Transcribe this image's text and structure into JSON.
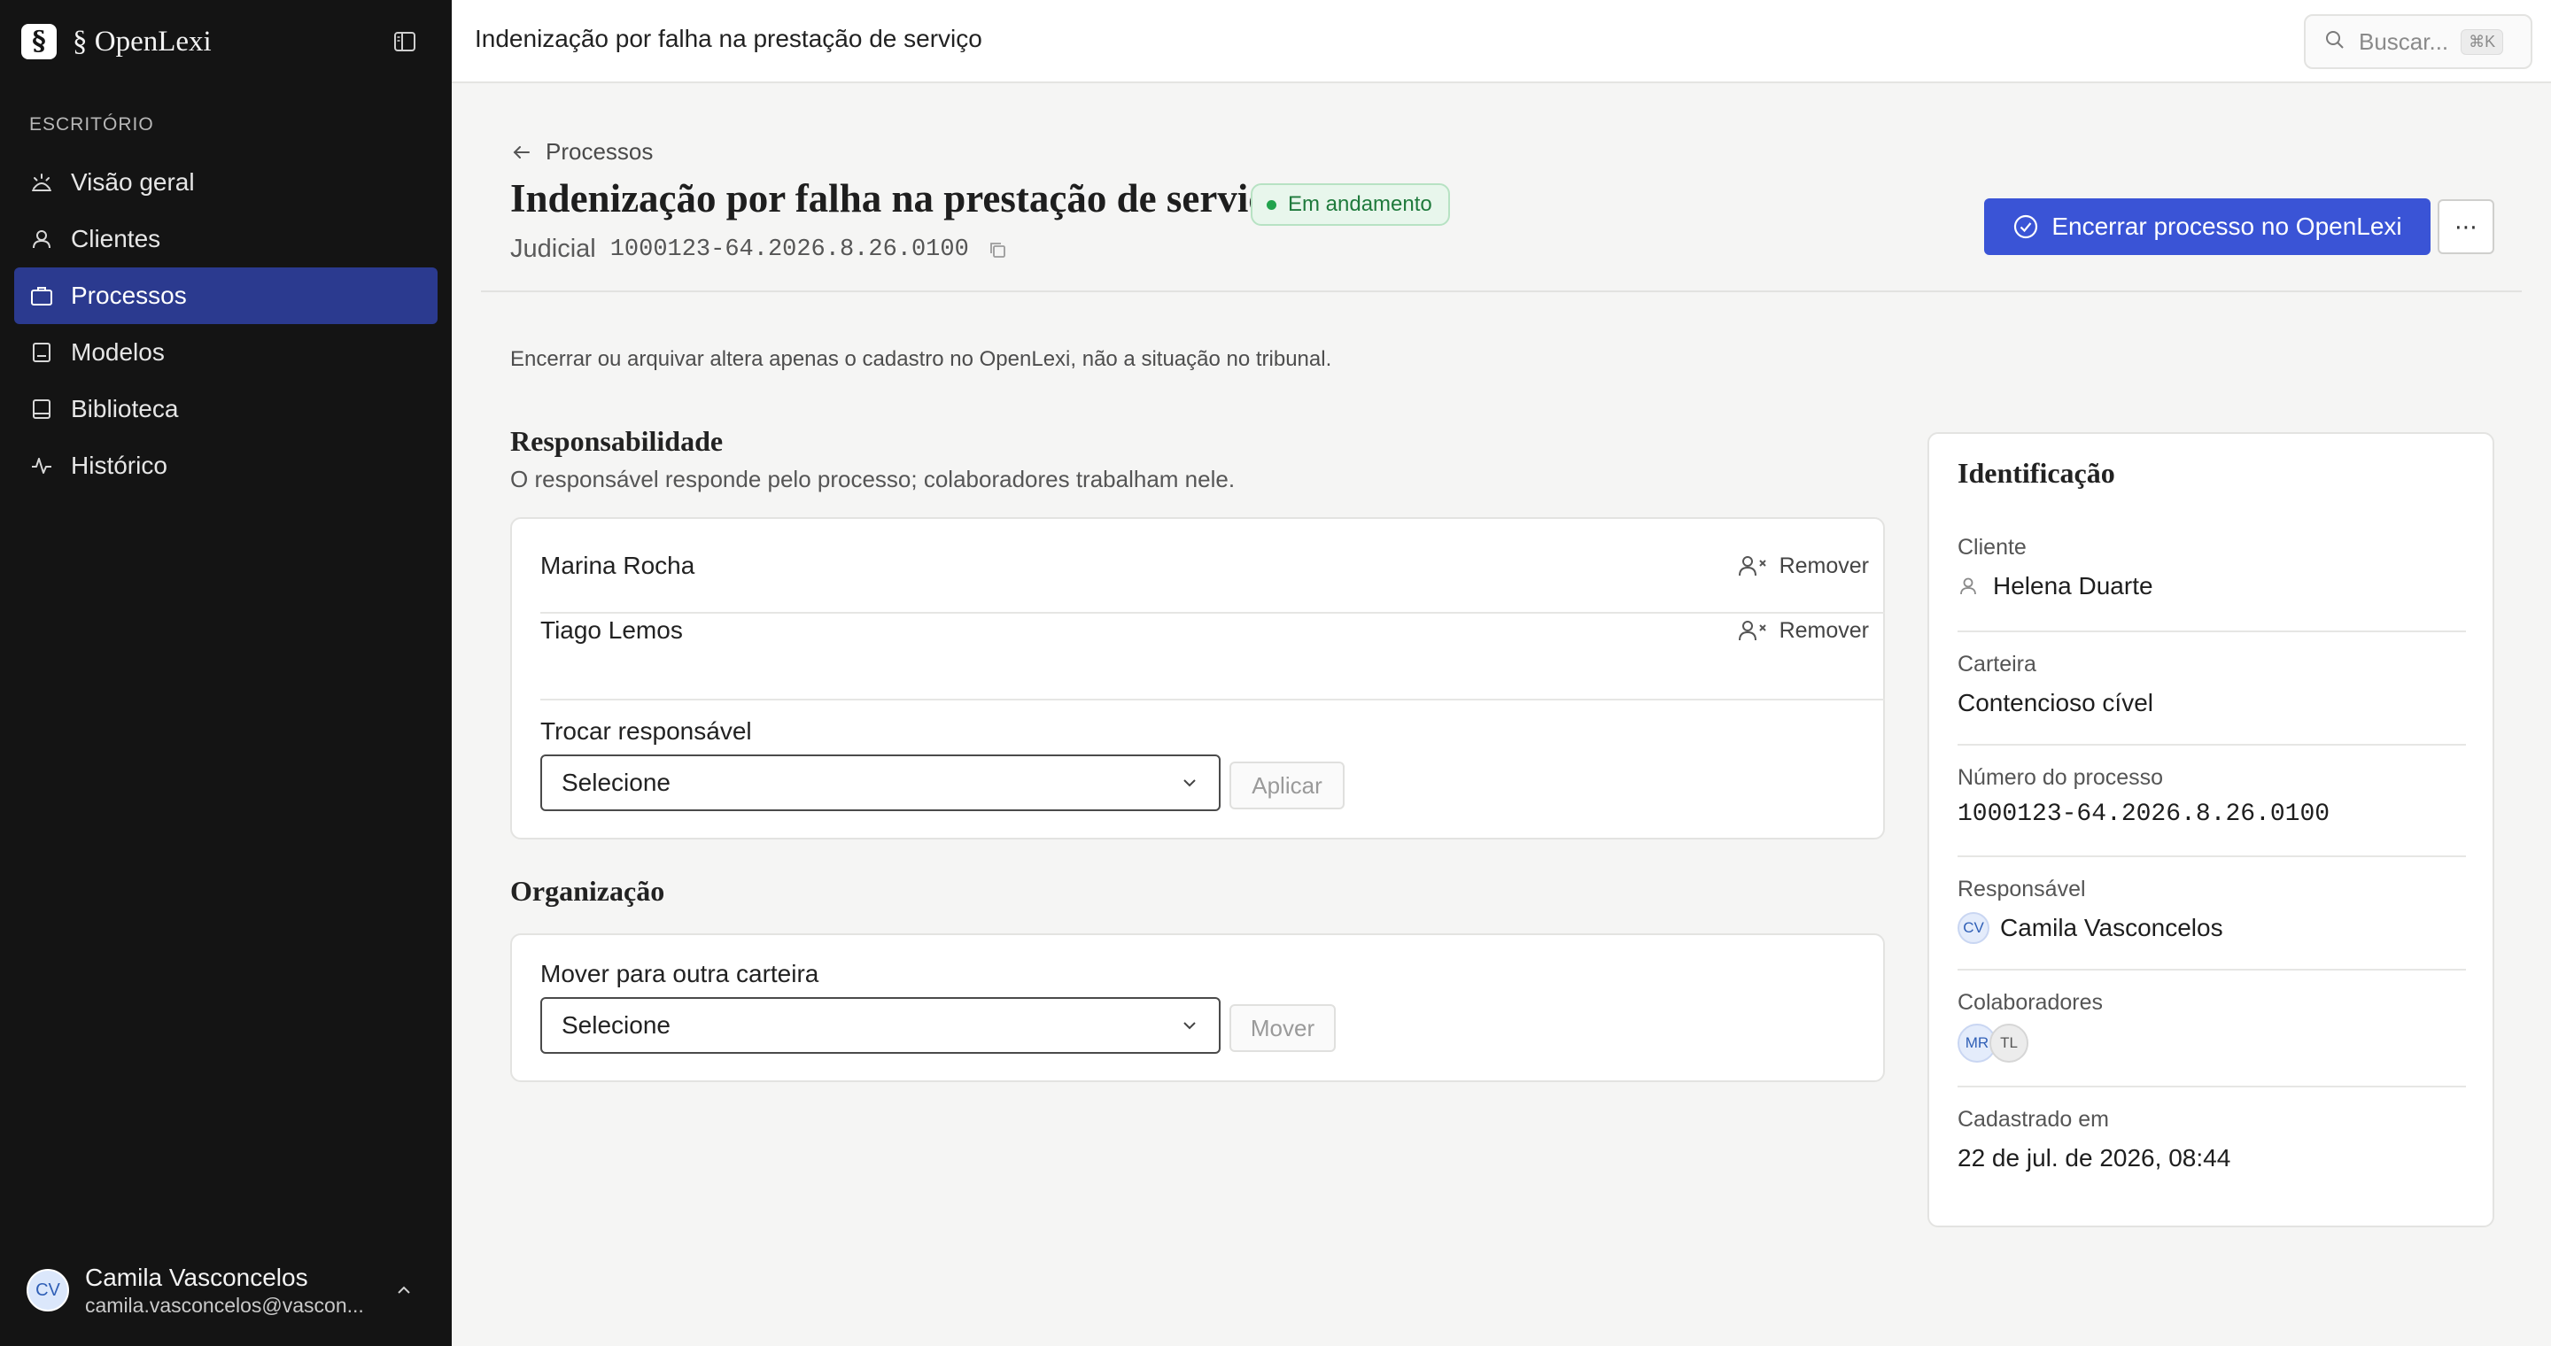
{
  "sidebar": {
    "logo_glyph": "§",
    "brand": "§ OpenLexi",
    "section_label": "ESCRITÓRIO",
    "items": [
      {
        "label": "Visão geral",
        "icon": "overview-icon",
        "active": false
      },
      {
        "label": "Clientes",
        "icon": "user-icon",
        "active": false
      },
      {
        "label": "Processos",
        "icon": "briefcase-icon",
        "active": true
      },
      {
        "label": "Modelos",
        "icon": "template-icon",
        "active": false
      },
      {
        "label": "Biblioteca",
        "icon": "book-icon",
        "active": false
      },
      {
        "label": "Histórico",
        "icon": "activity-icon",
        "active": false
      }
    ],
    "user": {
      "initials": "CV",
      "name": "Camila Vasconcelos",
      "email": "camila.vasconcelos@vascon..."
    }
  },
  "topbar": {
    "title": "Indenização por falha na prestação de serviço",
    "search_label": "Buscar...",
    "search_shortcut": "⌘K"
  },
  "header": {
    "back_label": "Processos",
    "title": "Indenização por falha na prestação de serviço",
    "status": "Em andamento",
    "type": "Judicial",
    "number": "1000123-64.2026.8.26.0100",
    "primary_action": "Encerrar processo no OpenLexi",
    "more_label": "⋯"
  },
  "notice": "Encerrar ou arquivar altera apenas o cadastro no OpenLexi, não a situação no tribunal.",
  "responsibility": {
    "title": "Responsabilidade",
    "subtitle": "O responsável responde pelo processo; colaboradores trabalham nele.",
    "people": [
      {
        "name": "Marina Rocha",
        "action": "Remover"
      },
      {
        "name": "Tiago Lemos",
        "action": "Remover"
      }
    ],
    "change_label": "Trocar responsável",
    "select_value": "Selecione",
    "apply_label": "Aplicar"
  },
  "organization": {
    "title": "Organização",
    "move_label": "Mover para outra carteira",
    "select_value": "Selecione",
    "move_button": "Mover"
  },
  "identification": {
    "title": "Identificação",
    "client_label": "Cliente",
    "client_value": "Helena Duarte",
    "portfolio_label": "Carteira",
    "portfolio_value": "Contencioso cível",
    "number_label": "Número do processo",
    "number_value": "1000123-64.2026.8.26.0100",
    "owner_label": "Responsável",
    "owner_initials": "CV",
    "owner_value": "Camila Vasconcelos",
    "collab_label": "Colaboradores",
    "collab_initials": [
      "MR",
      "TL"
    ],
    "created_label": "Cadastrado em",
    "created_value": "22 de jul. de 2026, 08:44"
  }
}
